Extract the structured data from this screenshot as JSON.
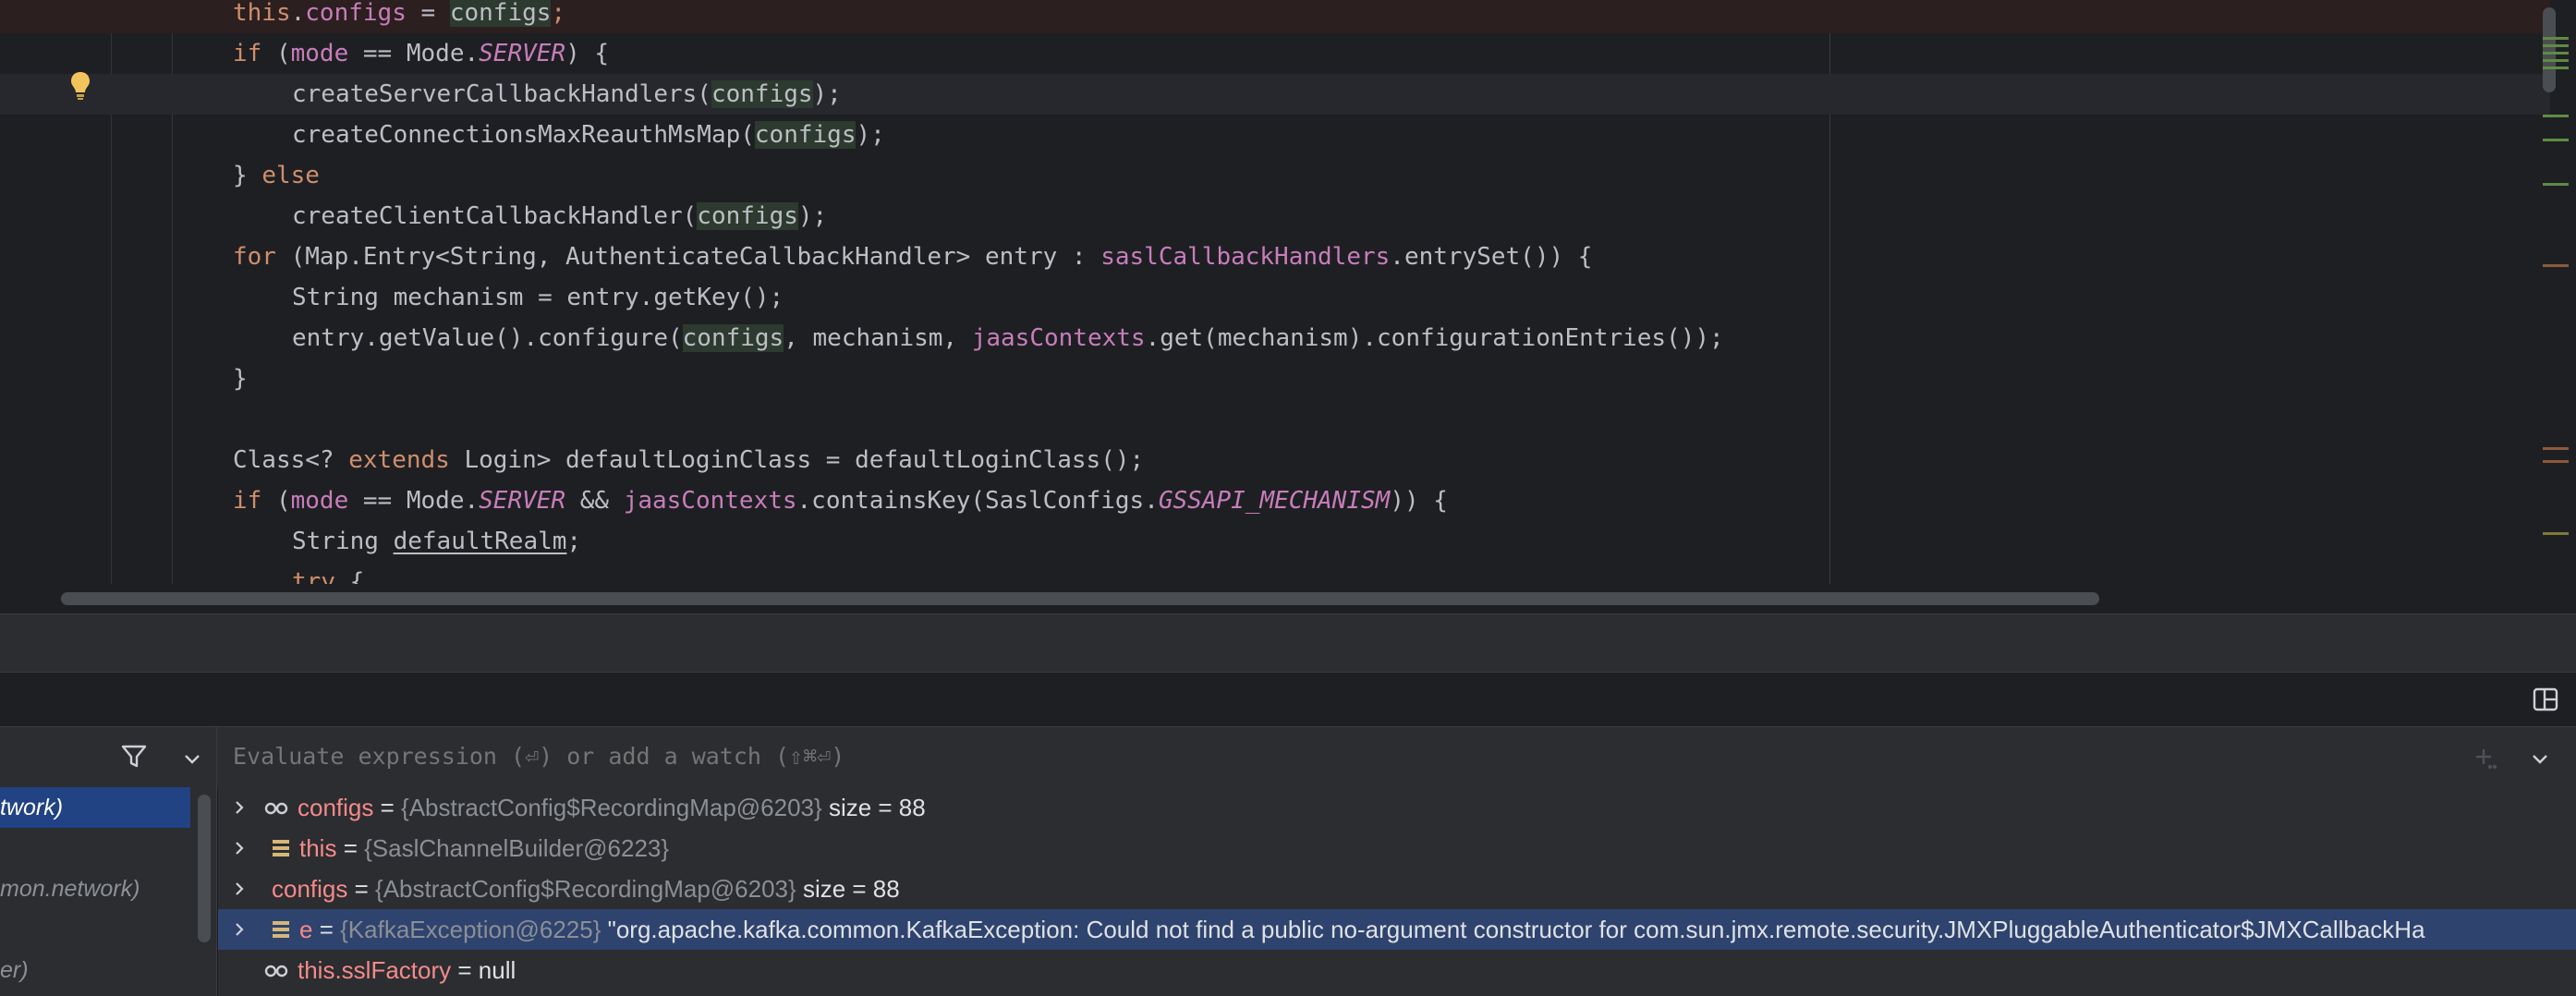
{
  "editor": {
    "lines": [
      {
        "indent": 0,
        "tokens": [
          {
            "t": "this",
            "c": "k"
          },
          {
            "t": "."
          },
          {
            "t": "configs",
            "c": "f"
          },
          {
            "t": " = "
          },
          {
            "t": "configs",
            "c": "hv"
          },
          {
            "t": ";",
            "c": "k"
          }
        ]
      },
      {
        "indent": 0,
        "tokens": [
          {
            "t": "if",
            "c": "k"
          },
          {
            "t": " ("
          },
          {
            "t": "mode",
            "c": "f"
          },
          {
            "t": " == Mode."
          },
          {
            "t": "SERVER",
            "c": "st"
          },
          {
            "t": ") {"
          }
        ]
      },
      {
        "indent": 1,
        "tokens": [
          {
            "t": "createServerCallbackHandlers("
          },
          {
            "t": "configs",
            "c": "hv"
          },
          {
            "t": ");"
          }
        ]
      },
      {
        "indent": 1,
        "tokens": [
          {
            "t": "createConnectionsMaxReauthMsMap("
          },
          {
            "t": "configs",
            "c": "hv"
          },
          {
            "t": ");"
          }
        ]
      },
      {
        "indent": 0,
        "tokens": [
          {
            "t": "} "
          },
          {
            "t": "else",
            "c": "k"
          }
        ]
      },
      {
        "indent": 1,
        "tokens": [
          {
            "t": "createClientCallbackHandler("
          },
          {
            "t": "configs",
            "c": "hv"
          },
          {
            "t": ");"
          }
        ]
      },
      {
        "indent": 0,
        "tokens": [
          {
            "t": "for",
            "c": "k"
          },
          {
            "t": " (Map.Entry<String, AuthenticateCallbackHandler> entry : "
          },
          {
            "t": "saslCallbackHandlers",
            "c": "f"
          },
          {
            "t": ".entrySet()) {"
          }
        ]
      },
      {
        "indent": 1,
        "tokens": [
          {
            "t": "String mechanism = entry.getKey();"
          }
        ]
      },
      {
        "indent": 1,
        "tokens": [
          {
            "t": "entry.getValue().configure("
          },
          {
            "t": "configs",
            "c": "hv"
          },
          {
            "t": ", mechanism, "
          },
          {
            "t": "jaasContexts",
            "c": "f"
          },
          {
            "t": ".get(mechanism).configurationEntries());"
          }
        ]
      },
      {
        "indent": 0,
        "tokens": [
          {
            "t": "}"
          }
        ]
      },
      {
        "indent": 0,
        "tokens": []
      },
      {
        "indent": 0,
        "tokens": [
          {
            "t": "Class<? "
          },
          {
            "t": "extends",
            "c": "k"
          },
          {
            "t": " Login> defaultLoginClass = defaultLoginClass();"
          }
        ]
      },
      {
        "indent": 0,
        "tokens": [
          {
            "t": "if",
            "c": "k"
          },
          {
            "t": " ("
          },
          {
            "t": "mode",
            "c": "f"
          },
          {
            "t": " == Mode."
          },
          {
            "t": "SERVER",
            "c": "st"
          },
          {
            "t": " && "
          },
          {
            "t": "jaasContexts",
            "c": "f"
          },
          {
            "t": ".containsKey(SaslConfigs."
          },
          {
            "t": "GSSAPI_MECHANISM",
            "c": "st"
          },
          {
            "t": ")) {"
          }
        ]
      },
      {
        "indent": 1,
        "tokens": [
          {
            "t": "String "
          },
          {
            "t": "defaultRealm",
            "c": "u"
          },
          {
            "t": ";"
          }
        ]
      },
      {
        "indent": 1,
        "tokens": [
          {
            "t": "try",
            "c": "k"
          },
          {
            "t": " {"
          }
        ]
      }
    ]
  },
  "debugger": {
    "eval_placeholder": "Evaluate expression (⏎) or add a watch (⇧⌘⏎)",
    "frames": [
      "twork)",
      "",
      "mon.network)",
      "",
      "er)"
    ],
    "variables": [
      {
        "icon": "watch-glasses-icon",
        "name": "configs",
        "eq": " = ",
        "type": "{AbstractConfig$RecordingMap@6203}",
        "suffix": " size = 88",
        "expandable": true
      },
      {
        "icon": "field-icon",
        "name": "this",
        "eq": " = ",
        "type": "{SaslChannelBuilder@6223}",
        "suffix": "",
        "expandable": true
      },
      {
        "icon": "",
        "name": "configs",
        "eq": " = ",
        "type": "{AbstractConfig$RecordingMap@6203}",
        "suffix": " size = 88",
        "expandable": true
      },
      {
        "icon": "field-icon",
        "name": "e",
        "eq": " = ",
        "type": "{KafkaException@6225}",
        "suffix": " \"org.apache.kafka.common.KafkaException: Could not find a public no-argument constructor for com.sun.jmx.remote.security.JMXPluggableAuthenticator$JMXCallbackHa",
        "expandable": true
      },
      {
        "icon": "watch-glasses-icon",
        "name": "this.sslFactory",
        "eq": " = ",
        "type": "",
        "suffix": "null",
        "expandable": false
      }
    ]
  }
}
